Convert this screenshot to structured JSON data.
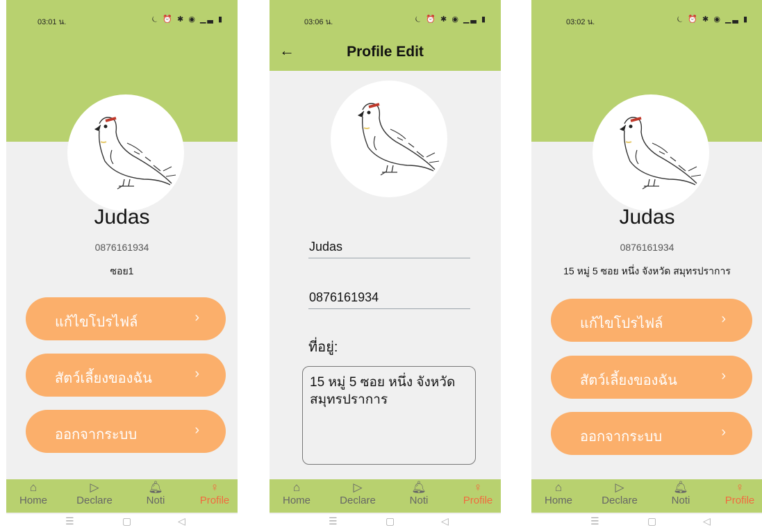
{
  "screens": [
    {
      "status_time": "03:01 น.",
      "status_icons": "⏾ ⏰ ✱ ◉ ▁▃ ▮",
      "user_name": "Judas",
      "user_phone": "0876161934",
      "user_address": "ซอย1",
      "menu": [
        {
          "label": "แก้ไขโปรไฟล์",
          "chevron": "›"
        },
        {
          "label": "สัตว์เลี้ยงของฉัน",
          "chevron": "›"
        },
        {
          "label": "ออกจากระบบ",
          "chevron": "›"
        }
      ]
    },
    {
      "status_time": "03:06 น.",
      "status_icons": "⏾ ⏰ ✱ ◉ ▁▃ ▮",
      "title": "Profile Edit",
      "back_icon": "←",
      "name_value": "Judas",
      "phone_value": "0876161934",
      "address_label": "ที่อยู่:",
      "address_value": "15 หมู่ 5 ซอย หนึ่ง จังหวัด\nสมุทรปราการ"
    },
    {
      "status_time": "03:02 น.",
      "status_icons": "⏾ ⏰ ✱ ◉ ▁▃ ▮",
      "user_name": "Judas",
      "user_phone": "0876161934",
      "user_address": "15 หมู่ 5 ซอย หนึ่ง จังหวัด สมุทรปราการ",
      "menu": [
        {
          "label": "แก้ไขโปรไฟล์",
          "chevron": "›"
        },
        {
          "label": "สัตว์เลี้ยงของฉัน",
          "chevron": "›"
        },
        {
          "label": "ออกจากระบบ",
          "chevron": "›"
        }
      ]
    }
  ],
  "bottom_nav": [
    {
      "label": "Home",
      "icon": "home-icon"
    },
    {
      "label": "Declare",
      "icon": "megaphone-icon"
    },
    {
      "label": "Noti",
      "icon": "bell-icon"
    },
    {
      "label": "Profile",
      "icon": "person-icon",
      "active": true
    }
  ],
  "system_nav": {
    "menu": "☰",
    "home": "▢",
    "back": "◁"
  },
  "colors": {
    "header_green": "#b8d16f",
    "button_orange": "#fbaf6b",
    "active_tab": "#f26a3f",
    "background": "#f0f0f0"
  }
}
